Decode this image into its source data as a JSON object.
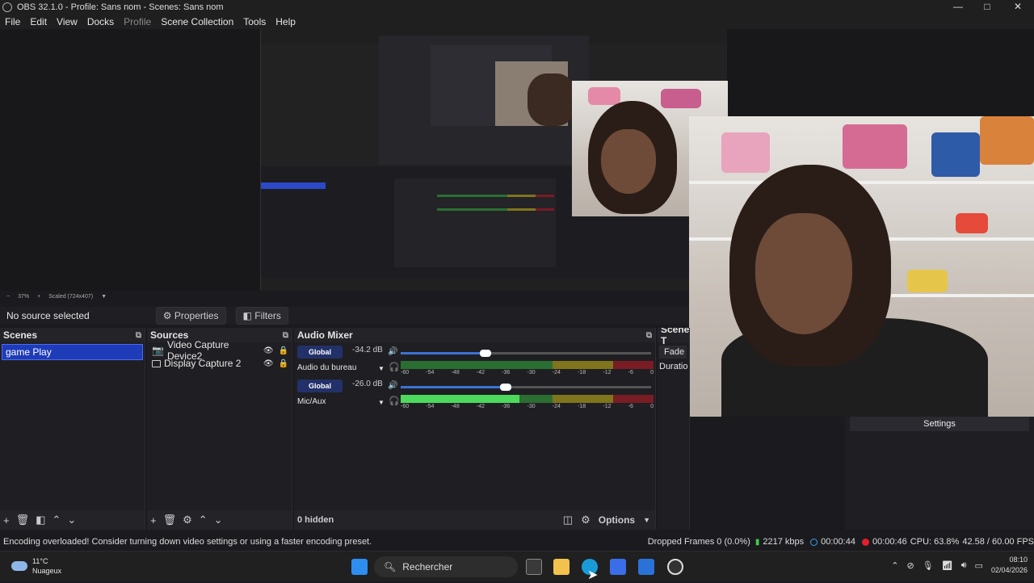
{
  "window": {
    "title": "OBS 32.1.0 - Profile: Sans nom - Scenes: Sans nom",
    "minimize": "—",
    "maximize": "□",
    "close": "✕"
  },
  "menu": [
    "File",
    "Edit",
    "View",
    "Docks",
    "Profile",
    "Scene Collection",
    "Tools",
    "Help"
  ],
  "zoom": {
    "level": "37%",
    "plus": "+",
    "minus": "−",
    "scaled": "Scaled (724x407)"
  },
  "source_toolbar": {
    "no_source": "No source selected",
    "properties": "Properties",
    "filters": "Filters"
  },
  "scenes": {
    "title": "Scenes",
    "items": [
      "game Play"
    ]
  },
  "sources": {
    "title": "Sources",
    "items": [
      {
        "name": "Video Capture Device2",
        "icon": "camera-icon"
      },
      {
        "name": "Display Capture 2",
        "icon": "monitor-icon"
      }
    ]
  },
  "mixer": {
    "title": "Audio Mixer",
    "channels": [
      {
        "name": "Audio du bureau",
        "db": "-34.2 dB",
        "global": "Global",
        "volume_pct": 0.34,
        "meter_level": 0.0
      },
      {
        "name": "Mic/Aux",
        "db": "-26.0 dB",
        "global": "Global",
        "volume_pct": 0.42,
        "meter_level": 0.47
      }
    ],
    "ticks": [
      "-60",
      "-54",
      "-48",
      "-42",
      "-36",
      "-30",
      "-24",
      "-18",
      "-12",
      "-6",
      "0"
    ],
    "hidden": "0 hidden",
    "options": "Options"
  },
  "transitions": {
    "title": "Scene T",
    "fade": "Fade",
    "duration": "Duratio"
  },
  "controls": {
    "settings": "Settings"
  },
  "status": {
    "message": "Encoding overloaded! Consider turning down video settings or using a faster encoding preset.",
    "dropped": "Dropped Frames 0 (0.0%)",
    "kbps": "2217 kbps",
    "stream_time": "00:00:44",
    "rec_time": "00:00:46",
    "cpu": "CPU: 63.8%",
    "fps": "42.58 / 60.00 FPS"
  },
  "taskbar": {
    "weather_temp": "11°C",
    "weather_desc": "Nuageux",
    "search": "Rechercher",
    "time": "08:10",
    "date": "02/04/2026"
  },
  "colors": {
    "accent": "#1f3cb8",
    "rec": "#e0202c",
    "meter_green": "#2a6e31",
    "meter_yellow": "#80741c",
    "meter_red": "#7a1c24"
  }
}
